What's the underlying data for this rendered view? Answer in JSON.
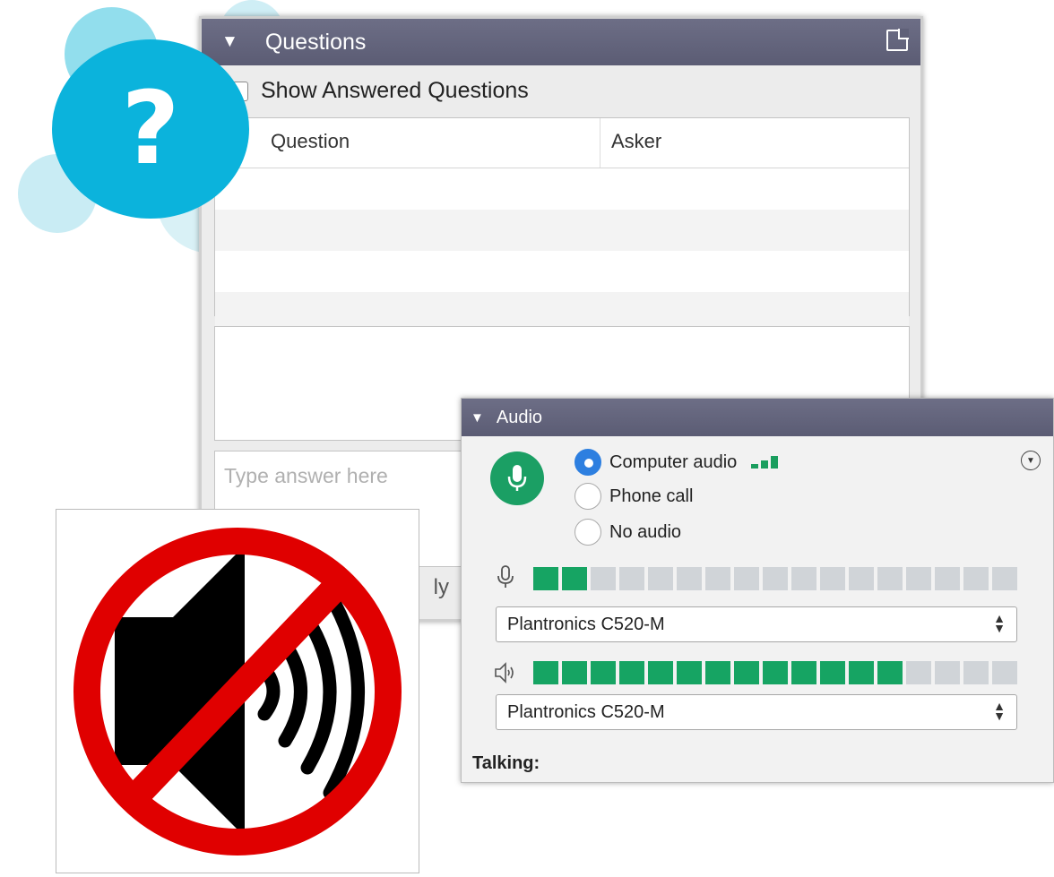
{
  "questions_panel": {
    "title": "Questions",
    "show_answered_label": "Show Answered Questions",
    "columns": [
      "Question",
      "Asker"
    ],
    "answer_placeholder": "Type answer here",
    "reply_label": "ly"
  },
  "help_bubble": {
    "glyph": "?"
  },
  "audio_panel": {
    "title": "Audio",
    "options": [
      {
        "label": "Computer audio",
        "selected": true
      },
      {
        "label": "Phone call",
        "selected": false
      },
      {
        "label": "No audio",
        "selected": false
      }
    ],
    "mic_level": {
      "active_segments": 2,
      "total_segments": 17
    },
    "speaker_level": {
      "active_segments": 13,
      "total_segments": 17
    },
    "mic_device": "Plantronics C520-M",
    "speaker_device": "Plantronics C520-M",
    "talking_label": "Talking:"
  },
  "colors": {
    "header": "#5f6078",
    "accent_green": "#16a463",
    "accent_blue": "#0bb3dc",
    "no_sign_red": "#e00000"
  },
  "icons": [
    "popout-icon",
    "microphone-icon",
    "speaker-icon",
    "no-sound-icon",
    "question-icon",
    "more-options-icon"
  ]
}
